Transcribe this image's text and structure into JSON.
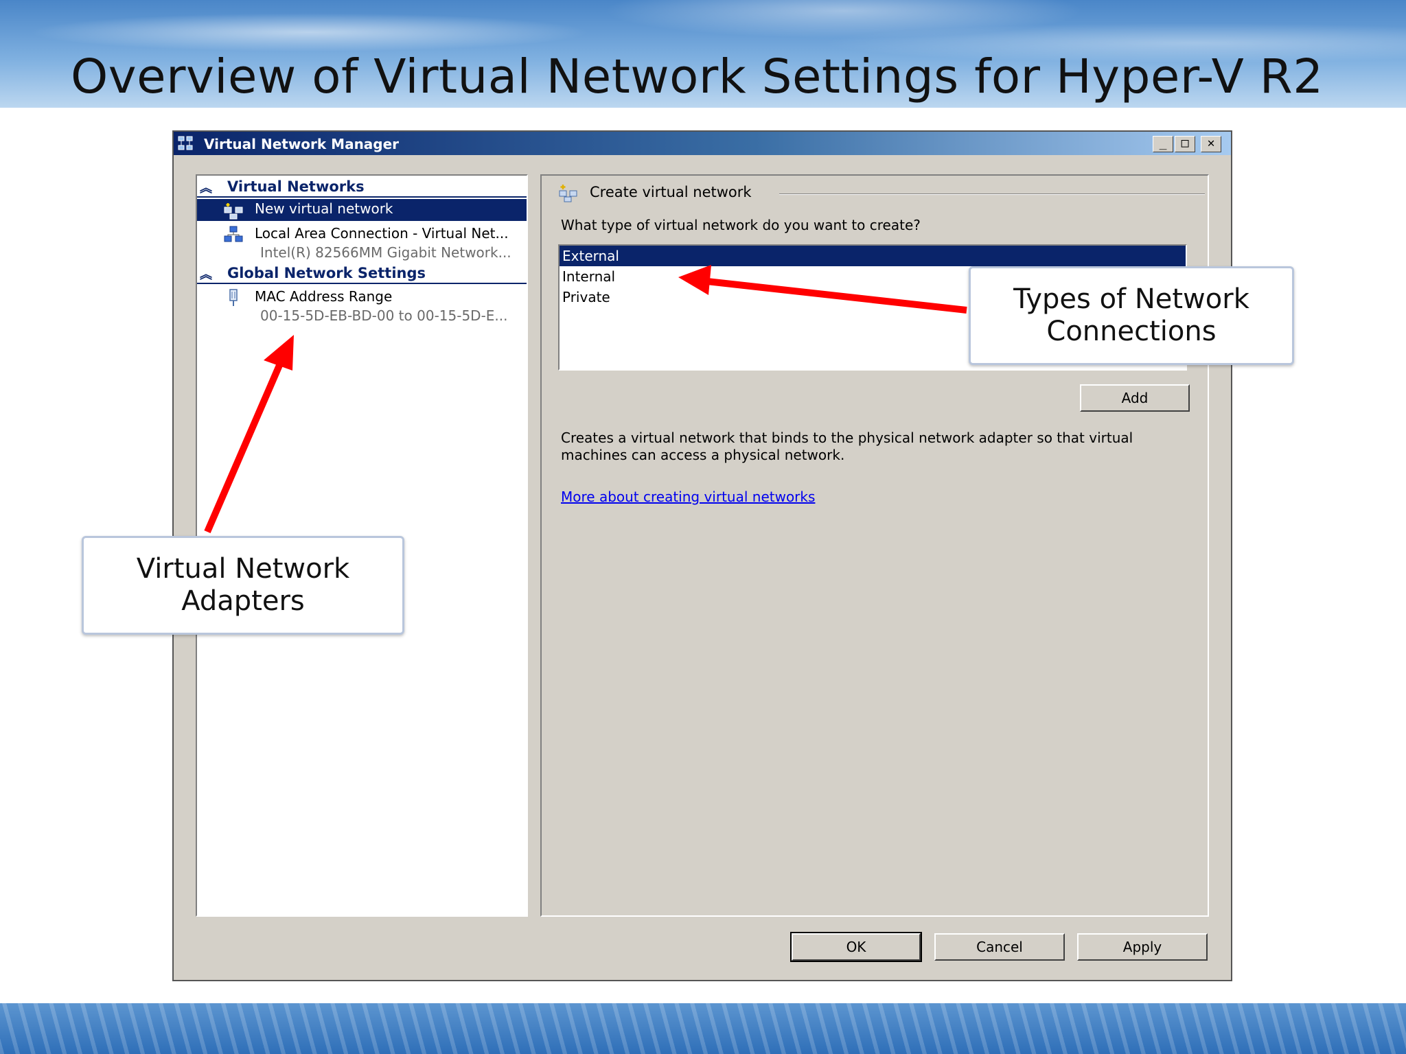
{
  "slide": {
    "title": "Overview of Virtual Network Settings for Hyper-V R2"
  },
  "window": {
    "title": "Virtual Network Manager",
    "controls": {
      "minimize": "_",
      "maximize": "□",
      "close": "✕"
    }
  },
  "left_pane": {
    "sections": [
      {
        "label": "Virtual Networks",
        "items": [
          {
            "label": "New virtual network",
            "selected": true,
            "icon": "new-network-icon"
          },
          {
            "label": "Local Area Connection - Virtual Net...",
            "sub": "Intel(R) 82566MM Gigabit Network...",
            "icon": "network-connection-icon"
          }
        ]
      },
      {
        "label": "Global Network Settings",
        "items": [
          {
            "label": "MAC Address Range",
            "sub": "00-15-5D-EB-BD-00 to 00-15-5D-E...",
            "icon": "mac-address-icon"
          }
        ]
      }
    ]
  },
  "right_pane": {
    "group_title": "Create virtual network",
    "question": "What type of virtual network do you want to create?",
    "options": [
      "External",
      "Internal",
      "Private"
    ],
    "selected_option": "External",
    "add_label": "Add",
    "description": "Creates a virtual network that binds to the physical network adapter so that virtual machines can access a physical network.",
    "help_link": "More about creating virtual networks"
  },
  "footer_buttons": {
    "ok": "OK",
    "cancel": "Cancel",
    "apply": "Apply"
  },
  "callouts": {
    "adapters": "Virtual Network Adapters",
    "connections": "Types of Network Connections"
  },
  "colors": {
    "selection": "#0a246a",
    "arrow": "#ff0000",
    "dialog_face": "#d4d0c8"
  }
}
